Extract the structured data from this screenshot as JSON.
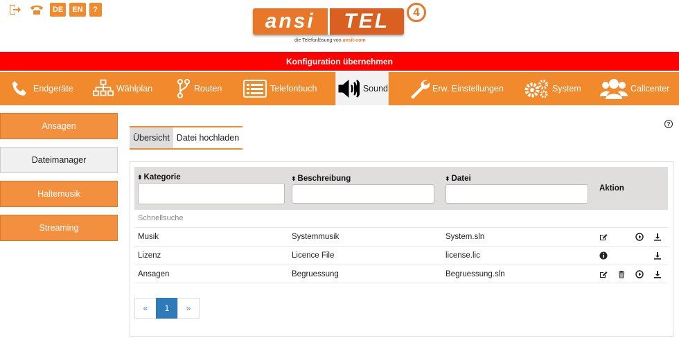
{
  "header": {
    "icons": [
      {
        "name": "logout-icon",
        "label": ""
      },
      {
        "name": "phone-icon",
        "label": ""
      },
      {
        "name": "lang-de",
        "label": "DE"
      },
      {
        "name": "lang-en",
        "label": "EN"
      },
      {
        "name": "help-icon",
        "label": "?"
      }
    ],
    "logo": {
      "left": "ansi",
      "right": "TEL",
      "badge": "4",
      "tagline": "die Telefonlösung von",
      "tagline_brand": "ansit-com"
    }
  },
  "config_bar": "Konfiguration übernehmen",
  "nav": [
    {
      "icon": "phone-icon",
      "label": "Endgeräte"
    },
    {
      "icon": "sitemap-icon",
      "label": "Wählplan"
    },
    {
      "icon": "route-icon",
      "label": "Routen"
    },
    {
      "icon": "phonebook-icon",
      "label": "Telefonbuch"
    },
    {
      "icon": "speaker-icon",
      "label": "Sound",
      "active": true
    },
    {
      "icon": "wrench-icon",
      "label": "Erw. Einstellungen"
    },
    {
      "icon": "gears-icon",
      "label": "System"
    },
    {
      "icon": "users-icon",
      "label": "Callcenter"
    }
  ],
  "sidebar": [
    {
      "label": "Ansagen"
    },
    {
      "label": "Dateimanager",
      "active": true
    },
    {
      "label": "Haltemusik"
    },
    {
      "label": "Streaming"
    }
  ],
  "tabs": [
    {
      "label": "Übersicht",
      "active": true
    },
    {
      "label": "Datei hochladen"
    }
  ],
  "table": {
    "columns": {
      "kategorie": "Kategorie",
      "beschreibung": "Beschreibung",
      "datei": "Datei",
      "aktion": "Aktion"
    },
    "quick_search": "Schnellsuche",
    "rows": [
      {
        "kategorie": "Musik",
        "beschreibung": "Systemmusik",
        "datei": "System.sln",
        "actions": [
          "edit",
          "play",
          "download"
        ]
      },
      {
        "kategorie": "Lizenz",
        "beschreibung": "Licence File",
        "datei": "license.lic",
        "actions": [
          "info",
          "download"
        ]
      },
      {
        "kategorie": "Ansagen",
        "beschreibung": "Begruessung",
        "datei": "Begruessung.sln",
        "actions": [
          "edit",
          "delete",
          "play",
          "download"
        ]
      }
    ]
  },
  "pagination": {
    "prev": "«",
    "current": "1",
    "next": "»"
  },
  "colors": {
    "accent": "#f08a2c",
    "alert": "#ff0000",
    "page_active": "#2f7ab9"
  }
}
